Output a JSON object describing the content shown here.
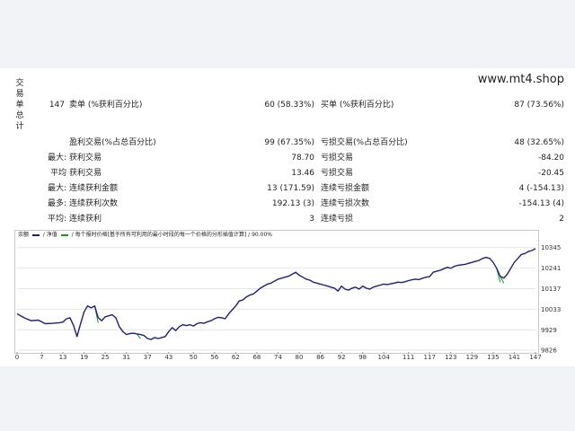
{
  "side_title": [
    "交",
    "易",
    "单",
    "总",
    "计"
  ],
  "site": "www.mt4.shop",
  "stats": {
    "short_label": "卖单 (%获利百分比)",
    "short_count": "147",
    "short_value": "60 (58.33%)",
    "long_label": "买单 (%获利百分比)",
    "long_value": "87 (73.56%)",
    "profit_trades_label": "盈利交易(%占总百分比)",
    "profit_trades_value": "99 (67.35%)",
    "loss_trades_label": "亏损交易(%占总百分比)",
    "loss_trades_value": "48 (32.65%)",
    "largest_prefix": "最大:",
    "largest_profit_label": "获利交易",
    "largest_profit_value": "78.70",
    "largest_loss_label": "亏损交易",
    "largest_loss_value": "-84.20",
    "average_prefix": "平均",
    "average_profit_label": "获利交易",
    "average_profit_value": "13.46",
    "average_loss_label": "亏损交易",
    "average_loss_value": "-20.45",
    "max_prefix": "最大:",
    "max_consec_wins_label": "连续获利金额",
    "max_consec_wins_value": "13 (171.59)",
    "max_consec_losses_label": "连续亏损金额",
    "max_consec_losses_value": "4 (-154.13)",
    "most_prefix": "最多:",
    "max_consec_profit_label": "连续获利次数",
    "max_consec_profit_value": "192.13 (3)",
    "max_consec_loss_label": "连续亏损次数",
    "max_consec_loss_value": "-154.13 (4)",
    "avg_prefix": "平均:",
    "avg_consec_wins_label": "连续获利",
    "avg_consec_wins_value": "3",
    "avg_consec_losses_label": "连续亏损",
    "avg_consec_losses_value": "2"
  },
  "legend": {
    "balance": "余额",
    "equity": "净值",
    "model": "每个报时价格[基于所有可利用的最小时段的每一个价格的分形插值计算]",
    "quality": "90.00%"
  },
  "colors": {
    "balance": "#1c1c8c",
    "equity": "#12a012",
    "grid": "#e6e6e6"
  },
  "chart_data": {
    "type": "line",
    "ylim": [
      9826,
      10380
    ],
    "yticks": [
      10345,
      10241,
      10137,
      10033,
      9929,
      9826
    ],
    "xticks": [
      0,
      7,
      13,
      19,
      25,
      31,
      37,
      43,
      50,
      56,
      62,
      68,
      74,
      80,
      86,
      92,
      98,
      104,
      111,
      117,
      123,
      129,
      135,
      141,
      147
    ],
    "x": [
      0,
      2,
      4,
      6,
      8,
      10,
      12,
      13,
      14,
      15,
      16,
      17,
      18,
      19,
      20,
      21,
      22,
      23,
      24,
      25,
      26,
      27,
      28,
      29,
      30,
      31,
      32,
      33,
      34,
      35,
      36,
      37,
      38,
      39,
      40,
      41,
      42,
      43,
      44,
      45,
      46,
      47,
      48,
      49,
      50,
      51,
      52,
      53,
      54,
      55,
      56,
      57,
      58,
      59,
      60,
      61,
      62,
      63,
      64,
      65,
      66,
      67,
      68,
      69,
      70,
      71,
      72,
      73,
      74,
      75,
      76,
      77,
      78,
      79,
      80,
      81,
      82,
      83,
      84,
      85,
      86,
      87,
      88,
      89,
      90,
      91,
      92,
      93,
      94,
      95,
      96,
      97,
      98,
      99,
      100,
      101,
      102,
      103,
      104,
      105,
      106,
      107,
      108,
      109,
      110,
      111,
      112,
      113,
      114,
      115,
      116,
      117,
      118,
      119,
      120,
      121,
      122,
      123,
      124,
      125,
      126,
      127,
      128,
      129,
      130,
      131,
      132,
      133,
      134,
      135,
      136,
      137,
      138,
      139,
      140,
      141,
      142,
      143,
      144,
      145,
      146,
      147
    ],
    "series": [
      {
        "name": "余额",
        "values": [
          10010,
          9990,
          9975,
          9978,
          9960,
          9962,
          9965,
          9968,
          9985,
          9990,
          9952,
          9895,
          9960,
          10020,
          10050,
          10040,
          10050,
          9990,
          9975,
          9995,
          10000,
          10005,
          9990,
          9945,
          9920,
          9905,
          9910,
          9912,
          9908,
          9905,
          9900,
          9885,
          9880,
          9890,
          9885,
          9890,
          9895,
          9920,
          9940,
          9925,
          9945,
          9955,
          9950,
          9955,
          9948,
          9960,
          9965,
          9962,
          9970,
          9975,
          9985,
          9992,
          9990,
          9985,
          10010,
          10030,
          10050,
          10075,
          10080,
          10095,
          10105,
          10110,
          10125,
          10140,
          10150,
          10160,
          10165,
          10175,
          10185,
          10190,
          10195,
          10200,
          10210,
          10220,
          10205,
          10195,
          10185,
          10180,
          10170,
          10165,
          10160,
          10155,
          10150,
          10145,
          10140,
          10125,
          10150,
          10135,
          10130,
          10140,
          10145,
          10135,
          10150,
          10140,
          10135,
          10145,
          10150,
          10155,
          10160,
          10158,
          10162,
          10165,
          10170,
          10168,
          10172,
          10178,
          10182,
          10185,
          10183,
          10190,
          10195,
          10198,
          10220,
          10225,
          10230,
          10238,
          10245,
          10240,
          10250,
          10255,
          10258,
          10260,
          10265,
          10270,
          10275,
          10280,
          10290,
          10295,
          10290,
          10270,
          10240,
          10200,
          10190,
          10210,
          10240,
          10270,
          10290,
          10310,
          10315,
          10325,
          10330,
          10340,
          10350
        ]
      }
    ]
  }
}
